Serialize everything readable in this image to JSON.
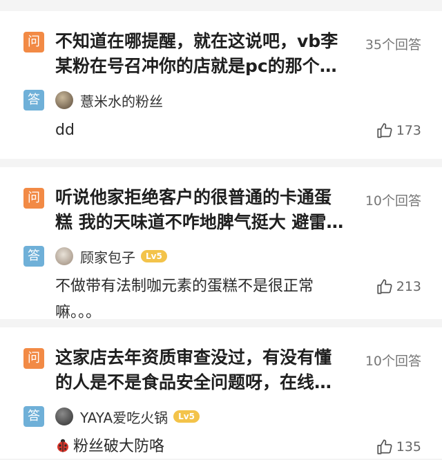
{
  "questions": [
    {
      "badge": "问",
      "text": "不知道在哪提醒，就在这说吧，vb李某粉在号召冲你的店就是pc的那个…",
      "count": "35个回答",
      "answer": {
        "badge": "答",
        "user": "薏米水的粉丝",
        "level": "",
        "text": "dd",
        "likes": "173"
      }
    },
    {
      "badge": "问",
      "text": "听说他家拒绝客户的很普通的卡通蛋糕 我的天味道不咋地脾气挺大 避雷…",
      "count": "10个回答",
      "answer": {
        "badge": "答",
        "user": "顾家包子",
        "level": "Lv5",
        "text": "不做带有法制咖元素的蛋糕不是很正常嘛。。。",
        "likes": "213"
      }
    },
    {
      "badge": "问",
      "text": "这家店去年资质审查没过，有没有懂的人是不是食品安全问题呀，在线…",
      "count": "10个回答",
      "answer": {
        "badge": "答",
        "user": "YAYA爱吃火锅",
        "level": "Lv5",
        "text": "粉丝破大防咯",
        "likes": "135"
      }
    }
  ],
  "icons": {
    "like": "thumbs-up-icon",
    "emoji": "ladybug-icon"
  },
  "colors": {
    "question_badge": "#f28a45",
    "answer_badge": "#6fb0d8",
    "level_badge": "#f3c34a"
  }
}
